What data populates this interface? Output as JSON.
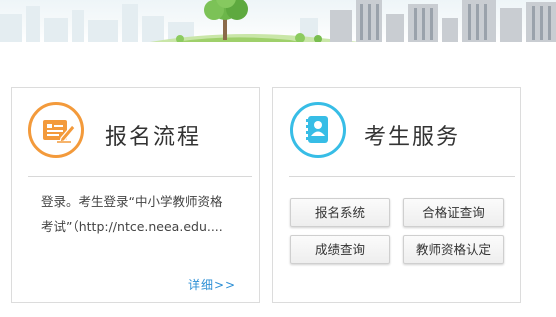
{
  "banner": {
    "scene": "city-skyline-with-tree"
  },
  "process_card": {
    "icon": "pen-on-form-icon",
    "accent_color": "#f39a3b",
    "title": "报名流程",
    "description_line1": "登录。考生登录“中小学教师资格",
    "description_line2": "考试”（http://ntce.neea.edu....",
    "more_label": "详细>>"
  },
  "service_card": {
    "icon": "person-id-book-icon",
    "accent_color": "#37bde6",
    "title": "考生服务",
    "buttons": {
      "registration": "报名系统",
      "certificate_query": "合格证查询",
      "score_query": "成绩查询",
      "teacher_qualification": "教师资格认定"
    }
  }
}
